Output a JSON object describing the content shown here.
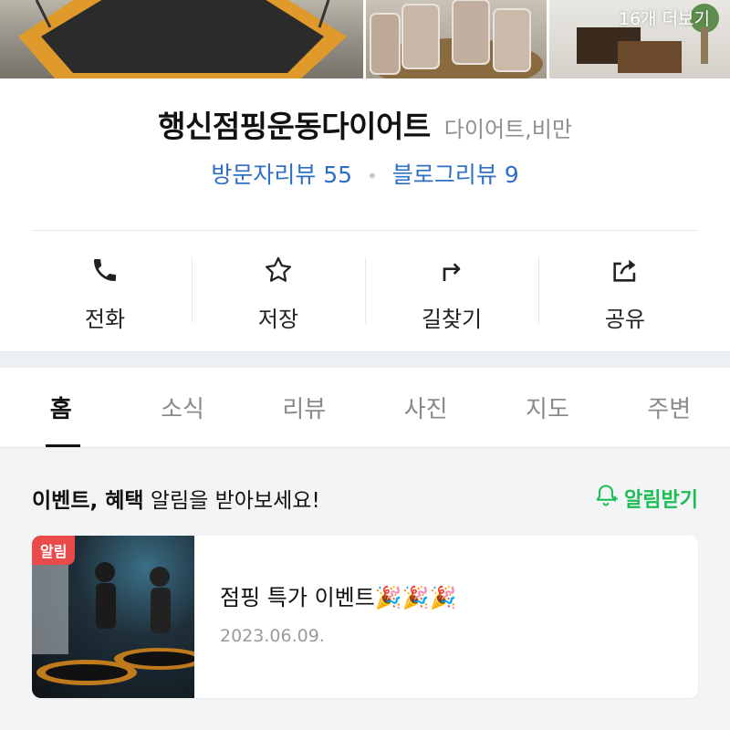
{
  "photos": {
    "more_label": "16개 더보기"
  },
  "place": {
    "name": "행신점핑운동다이어트",
    "category": "다이어트,비만"
  },
  "reviews": {
    "visitor_label": "방문자리뷰 55",
    "separator": "•",
    "blog_label": "블로그리뷰 9"
  },
  "actions": [
    {
      "label": "전화",
      "icon": "phone-icon"
    },
    {
      "label": "저장",
      "icon": "star-icon"
    },
    {
      "label": "길찾기",
      "icon": "directions-icon"
    },
    {
      "label": "공유",
      "icon": "share-icon"
    }
  ],
  "tabs": [
    {
      "label": "홈",
      "active": true
    },
    {
      "label": "소식"
    },
    {
      "label": "리뷰"
    },
    {
      "label": "사진"
    },
    {
      "label": "지도"
    },
    {
      "label": "주변"
    }
  ],
  "notice": {
    "bold_text": "이벤트, 혜택",
    "text": " 알림을 받아보세요!",
    "button_label": "알림받기"
  },
  "event_card": {
    "badge": "알림",
    "title": "점핑 특가 이벤트🎉🎉🎉",
    "date": "2023.06.09."
  },
  "colors": {
    "review_blue": "#2f6fc6",
    "alarm_green": "#1bbd54",
    "badge_red": "#e94b4b"
  }
}
